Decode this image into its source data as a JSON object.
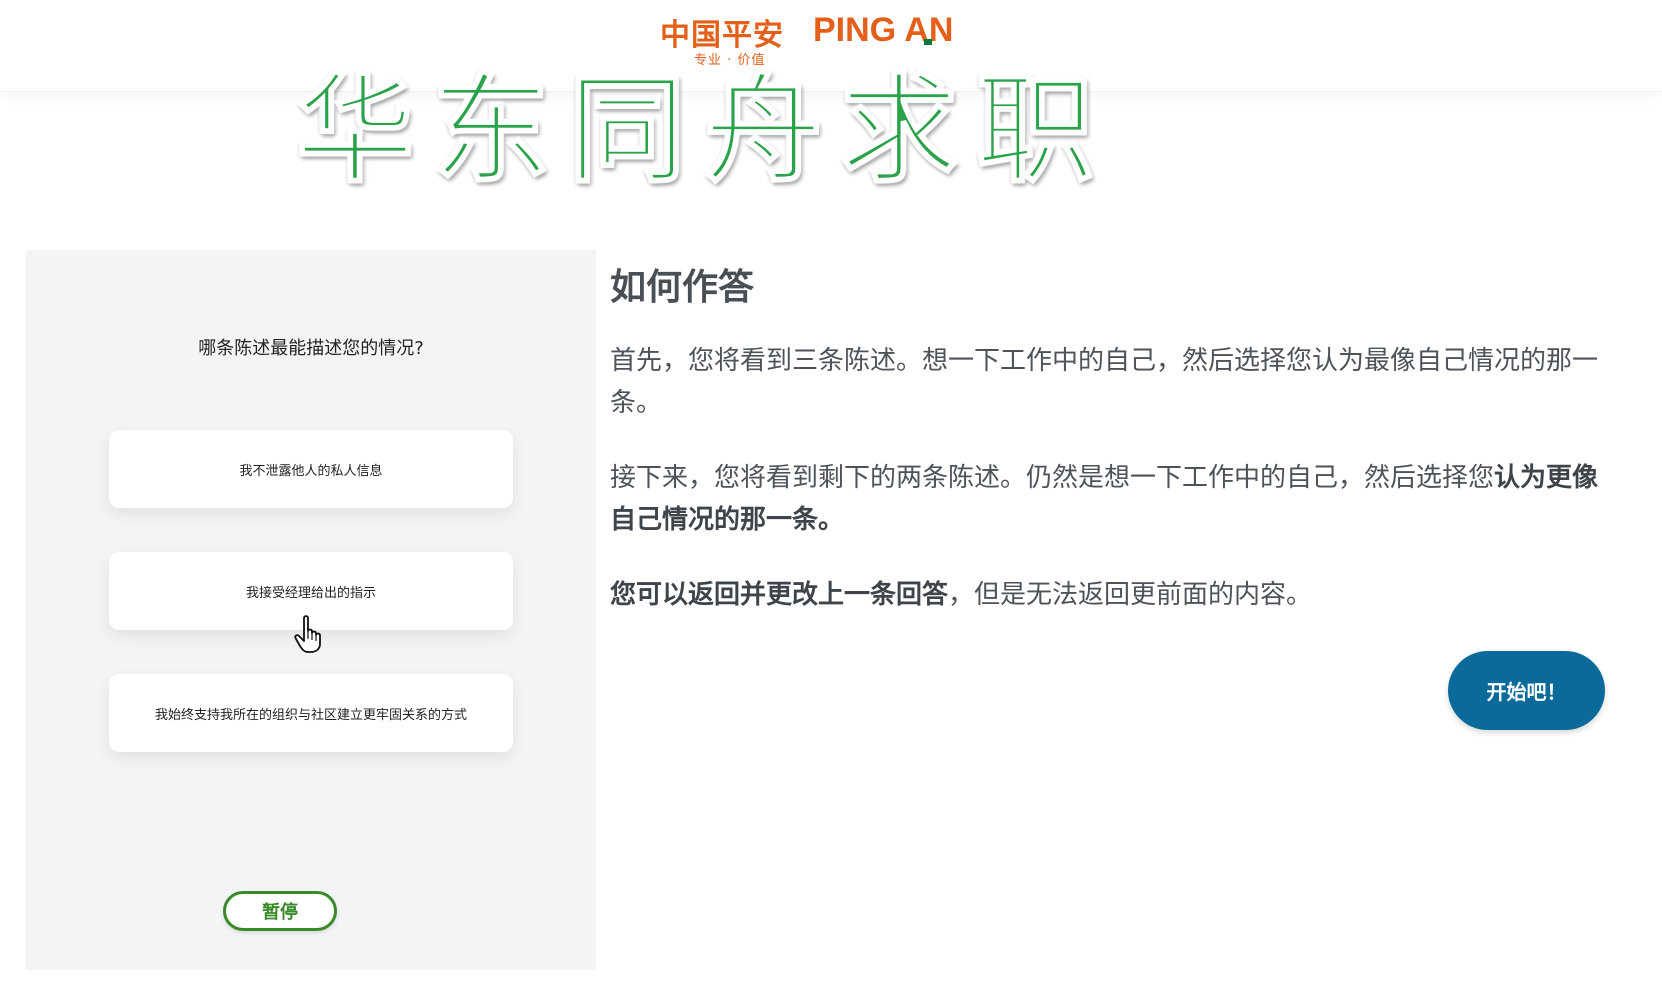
{
  "header": {
    "logo_cn": "中国平安",
    "logo_en": "PING AN",
    "logo_tagline": "专业 · 价值"
  },
  "watermark": "华东同舟求职",
  "demo": {
    "question": "哪条陈述最能描述您的情况?",
    "options": [
      "我不泄露他人的私人信息",
      "我接受经理给出的指示",
      "我始终支持我所在的组织与社区建立更牢固关系的方式"
    ],
    "pause_label": "暂停"
  },
  "instructions": {
    "title": "如何作答",
    "p1": "首先，您将看到三条陈述。想一下工作中的自己，然后选择您认为最像自己情况的那一条。",
    "p2_normal": "接下来，您将看到剩下的两条陈述。仍然是想一下工作中的自己，然后选择您",
    "p2_bold": "认为更像自己情况的那一条。",
    "p3_bold": "您可以返回并更改上一条回答",
    "p3_normal": "，但是无法返回更前面的内容。"
  },
  "start_label": "开始吧！",
  "colors": {
    "brand_orange": "#e4601a",
    "watermark_green": "#2aa24a",
    "pause_green": "#3a8a2a",
    "start_blue": "#0a6b9b",
    "panel_bg": "#f4f4f6"
  }
}
